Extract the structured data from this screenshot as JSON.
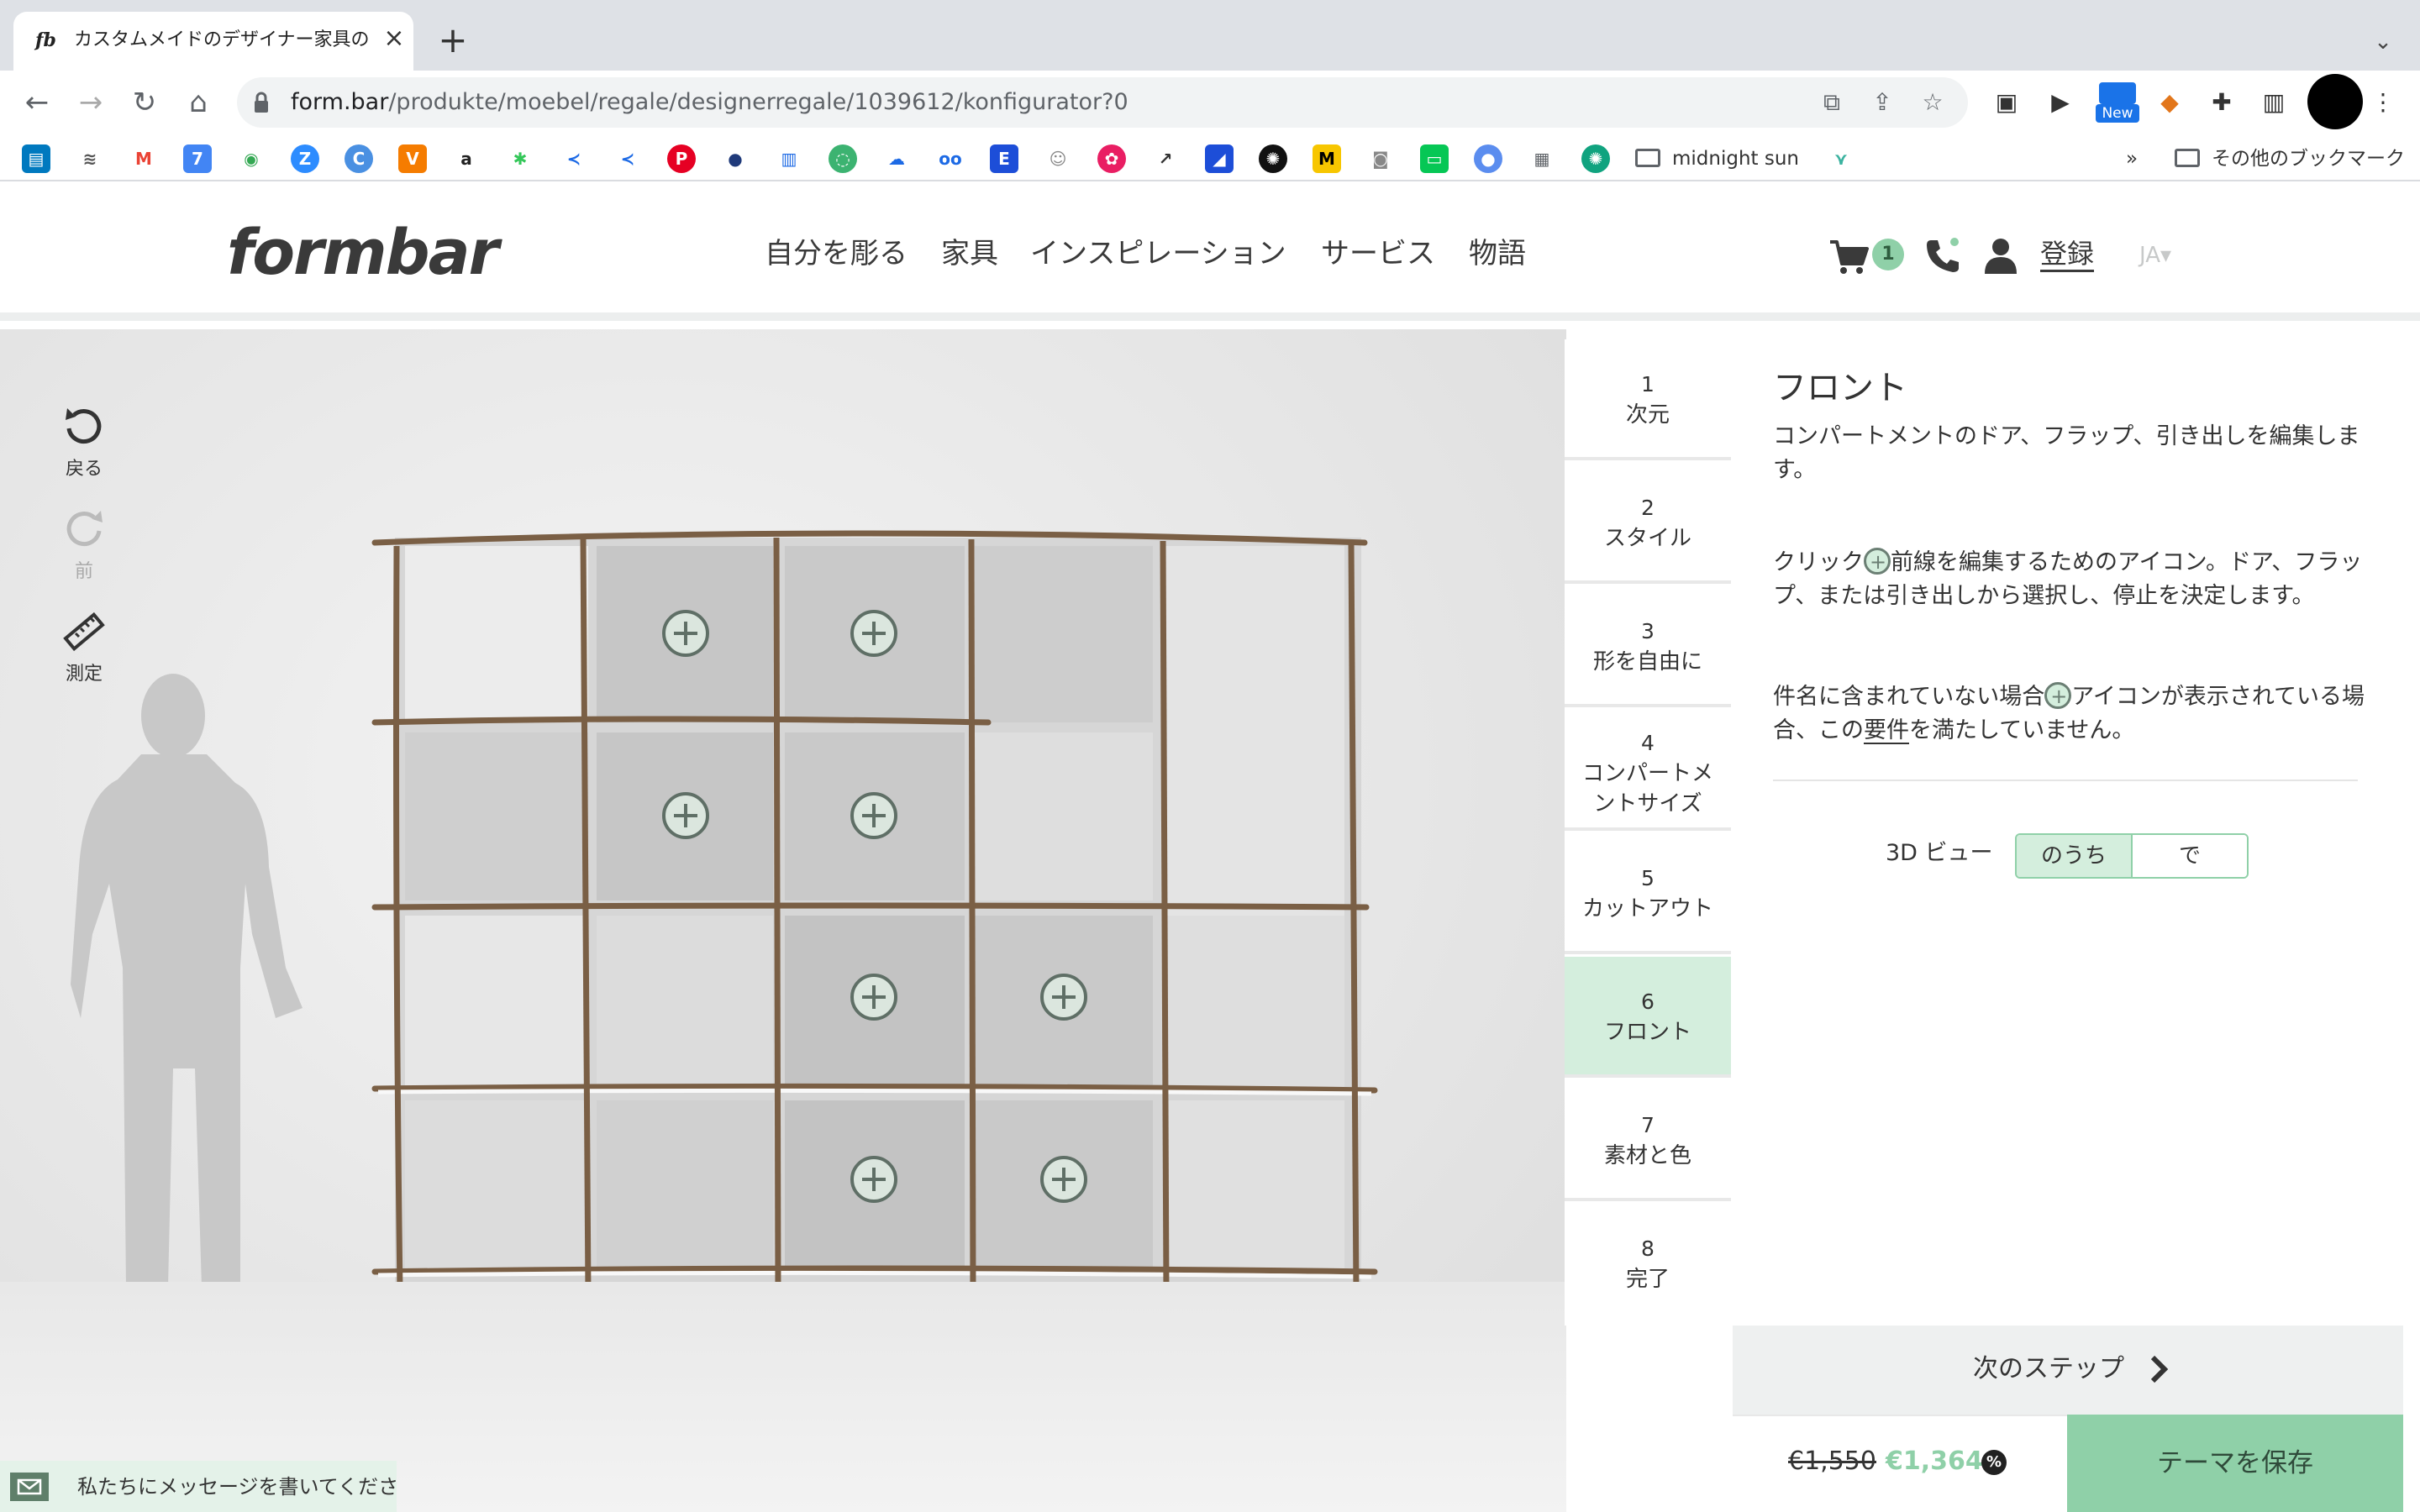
{
  "browser": {
    "tab_title": "カスタムメイドのデザイナー家具の",
    "tab_favicon": "fb",
    "url_host": "form.bar",
    "url_path": "/produkte/moebel/regale/designerregale/1039612/konfigurator?0",
    "extension_badge": "New",
    "bookmark_folder": "midnight sun",
    "bookmark_overflow": "»",
    "other_bookmarks": "その他のブックマーク"
  },
  "site": {
    "logo": "formbar",
    "nav": [
      "自分を彫る",
      "家具",
      "インスピレーション",
      "サービス",
      "物語"
    ],
    "cart_count": "1",
    "login": "登録",
    "lang": "JA▾"
  },
  "tools": {
    "undo": "戻る",
    "redo": "前",
    "measure": "測定"
  },
  "chat": {
    "text": "私たちにメッセージを書いてください"
  },
  "steps": [
    {
      "num": "1",
      "label": "次元"
    },
    {
      "num": "2",
      "label": "スタイル"
    },
    {
      "num": "3",
      "label": "形を自由に"
    },
    {
      "num": "4",
      "label": "コンパートメントサイズ"
    },
    {
      "num": "5",
      "label": "カットアウト"
    },
    {
      "num": "6",
      "label": "フロント"
    },
    {
      "num": "7",
      "label": "素材と色"
    },
    {
      "num": "8",
      "label": "完了"
    }
  ],
  "active_step": 6,
  "panel": {
    "title": "フロント",
    "intro": "コンパートメントのドア、フラップ、引き出しを編集します。",
    "p1_before": "クリック",
    "p1_after": "前線を編集するためのアイコン。ドア、フラップ、または引き出しから選択し、停止を決定します。",
    "p2_before": "件名に含まれていない場合",
    "p2_mid": "アイコンが表示されている場合、この",
    "p2_link": "要件",
    "p2_after": "を満たしていません。",
    "view3d_label": "3D ビュー",
    "view3d_on": "のうち",
    "view3d_off": "で"
  },
  "footer": {
    "next": "次のステップ",
    "price_old": "€1,550",
    "price_new": "€1,364",
    "discount_icon": "%",
    "save": "テーマを保存"
  },
  "colors": {
    "accent_green": "#8fd0a8",
    "accent_light": "#d4eedd",
    "shelf_wood": "#7a5f45"
  }
}
